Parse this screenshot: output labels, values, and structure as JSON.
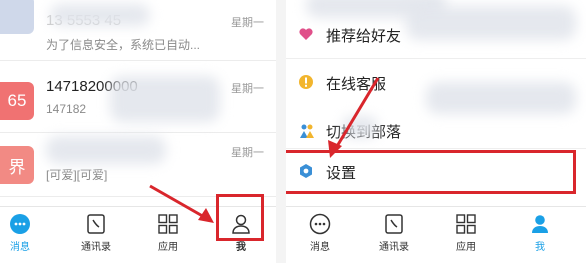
{
  "left_panel": {
    "chats": [
      {
        "title": "13 5553 45",
        "subtitle": "为了信息安全，系统已自动...",
        "time": "星期一",
        "avatar": ""
      },
      {
        "title": "14718200000",
        "subtitle": "147182",
        "time": "星期一",
        "avatar": "65"
      },
      {
        "title": "",
        "subtitle": "[可爱][可爱]",
        "time": "星期一",
        "avatar": "界"
      }
    ],
    "tabs": [
      {
        "label": "消息",
        "icon": "chat-bubble-icon",
        "active": true
      },
      {
        "label": "通讯录",
        "icon": "contacts-icon",
        "active": false
      },
      {
        "label": "应用",
        "icon": "apps-grid-icon",
        "active": false
      },
      {
        "label": "我",
        "icon": "person-icon",
        "active": false
      }
    ]
  },
  "right_panel": {
    "menu": [
      {
        "label": "推荐给好友",
        "icon": "heart-icon"
      },
      {
        "label": "在线客服",
        "icon": "customer-service-icon"
      },
      {
        "label": "切换到部落",
        "icon": "tribe-icon"
      },
      {
        "label": "设置",
        "icon": "settings-gear-icon"
      }
    ],
    "tabs": [
      {
        "label": "消息",
        "icon": "chat-bubble-icon",
        "active": false
      },
      {
        "label": "通讯录",
        "icon": "contacts-icon",
        "active": false
      },
      {
        "label": "应用",
        "icon": "apps-grid-icon",
        "active": false
      },
      {
        "label": "我",
        "icon": "person-icon",
        "active": true
      }
    ]
  },
  "colors": {
    "accent": "#1aa0e6",
    "annotation": "#d9262c",
    "avatar_red": "#f07272",
    "avatar_pink": "#f28a84"
  }
}
